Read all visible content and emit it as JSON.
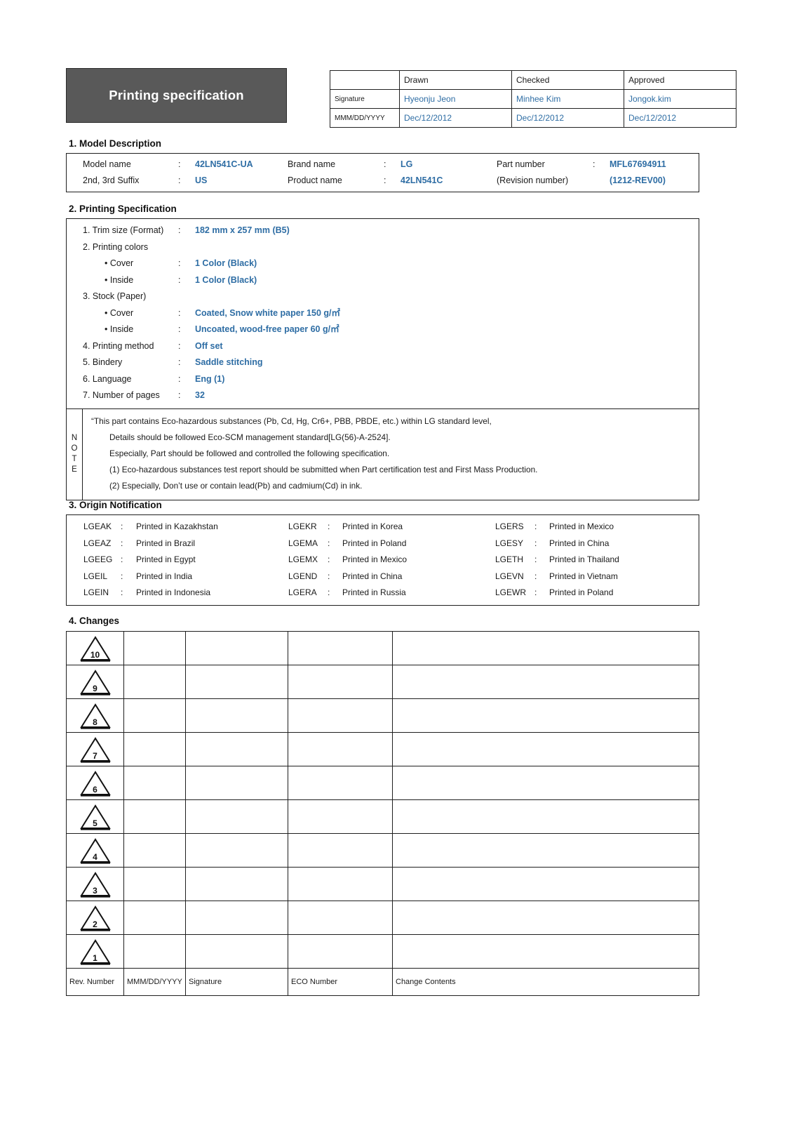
{
  "header": {
    "title": "Printing specification",
    "approval": {
      "row_labels": [
        "",
        "Signature",
        "MMM/DD/YYYY"
      ],
      "columns": [
        "Drawn",
        "Checked",
        "Approved"
      ],
      "signatures": [
        "Hyeonju Jeon",
        "Minhee Kim",
        "Jongok.kim"
      ],
      "dates": [
        "Dec/12/2012",
        "Dec/12/2012",
        "Dec/12/2012"
      ]
    }
  },
  "sections": {
    "model_description": {
      "heading": "1. Model Description",
      "rows": [
        {
          "c1_label": "Model name",
          "c1_colon": ":",
          "c1_value": "42LN541C-UA",
          "c2_label": "Brand name",
          "c2_colon": ":",
          "c2_value": "LG",
          "c3_label": "Part number",
          "c3_colon": ":",
          "c3_value": "MFL67694911"
        },
        {
          "c1_label": "2nd, 3rd Suffix",
          "c1_colon": ":",
          "c1_value": "US",
          "c2_label": "Product name",
          "c2_colon": ":",
          "c2_value": "42LN541C",
          "c3_label": "(Revision number)",
          "c3_colon": "",
          "c3_value": "(1212-REV00)"
        }
      ]
    },
    "printing_specification": {
      "heading": "2. Printing Specification",
      "items": [
        {
          "label": "1. Trim size (Format)",
          "indent": false,
          "colon": ":",
          "value": "182 mm x 257 mm (B5)"
        },
        {
          "label": "2. Printing colors",
          "indent": false,
          "colon": "",
          "value": ""
        },
        {
          "label": "• Cover",
          "indent": true,
          "colon": ":",
          "value": "1 Color (Black)"
        },
        {
          "label": "• Inside",
          "indent": true,
          "colon": ":",
          "value": "1 Color (Black)"
        },
        {
          "label": "3. Stock (Paper)",
          "indent": false,
          "colon": "",
          "value": ""
        },
        {
          "label": "• Cover",
          "indent": true,
          "colon": ":",
          "value": "Coated, Snow white paper 150 g/㎡"
        },
        {
          "label": "• Inside",
          "indent": true,
          "colon": ":",
          "value": "Uncoated, wood-free paper 60 g/㎡"
        },
        {
          "label": "4. Printing method",
          "indent": false,
          "colon": ":",
          "value": "Off set"
        },
        {
          "label": "5. Bindery",
          "indent": false,
          "colon": ":",
          "value": "Saddle stitching"
        },
        {
          "label": "6. Language",
          "indent": false,
          "colon": ":",
          "value": "Eng (1)"
        },
        {
          "label": "7. Number of pages",
          "indent": false,
          "colon": ":",
          "value": "32"
        }
      ],
      "note": {
        "side_label": "NOTE",
        "side_letters": [
          "N",
          "O",
          "T",
          "E"
        ],
        "lines": [
          {
            "text": "“This part contains Eco-hazardous substances (Pb, Cd, Hg, Cr6+, PBB, PBDE, etc.) within LG standard level,",
            "indent": false
          },
          {
            "text": "Details should be followed Eco-SCM management standard[LG(56)-A-2524].",
            "indent": true
          },
          {
            "text": "Especially, Part should be followed and controlled the following specification.",
            "indent": true
          },
          {
            "text": "(1) Eco-hazardous substances test report should be submitted when Part certification test and First Mass Production.",
            "indent": true
          },
          {
            "text": "(2) Especially, Don’t use or contain lead(Pb) and cadmium(Cd) in ink.",
            "indent": true
          }
        ]
      }
    },
    "origin_notification": {
      "heading": "3. Origin Notification",
      "colon": ":",
      "rows": [
        [
          {
            "code": "LGEAK",
            "text": "Printed in Kazakhstan"
          },
          {
            "code": "LGEKR",
            "text": "Printed in Korea"
          },
          {
            "code": "LGERS",
            "text": "Printed in Mexico"
          }
        ],
        [
          {
            "code": "LGEAZ",
            "text": "Printed in Brazil"
          },
          {
            "code": "LGEMA",
            "text": "Printed in Poland"
          },
          {
            "code": "LGESY",
            "text": "Printed in China"
          }
        ],
        [
          {
            "code": "LGEEG",
            "text": "Printed in Egypt"
          },
          {
            "code": "LGEMX",
            "text": "Printed in Mexico"
          },
          {
            "code": "LGETH",
            "text": "Printed in Thailand"
          }
        ],
        [
          {
            "code": "LGEIL",
            "text": "Printed in India"
          },
          {
            "code": "LGEND",
            "text": "Printed in China"
          },
          {
            "code": "LGEVN",
            "text": "Printed in Vietnam"
          }
        ],
        [
          {
            "code": "LGEIN",
            "text": "Printed in Indonesia"
          },
          {
            "code": "LGERA",
            "text": "Printed in Russia"
          },
          {
            "code": "LGEWR",
            "text": "Printed in Poland"
          }
        ]
      ]
    },
    "changes": {
      "heading": "4. Changes",
      "rev_numbers": [
        "10",
        "9",
        "8",
        "7",
        "6",
        "5",
        "4",
        "3",
        "2",
        "1"
      ],
      "rows": [
        {
          "rev": "10",
          "date": "",
          "signature": "",
          "eco": "",
          "contents": ""
        },
        {
          "rev": "9",
          "date": "",
          "signature": "",
          "eco": "",
          "contents": ""
        },
        {
          "rev": "8",
          "date": "",
          "signature": "",
          "eco": "",
          "contents": ""
        },
        {
          "rev": "7",
          "date": "",
          "signature": "",
          "eco": "",
          "contents": ""
        },
        {
          "rev": "6",
          "date": "",
          "signature": "",
          "eco": "",
          "contents": ""
        },
        {
          "rev": "5",
          "date": "",
          "signature": "",
          "eco": "",
          "contents": ""
        },
        {
          "rev": "4",
          "date": "",
          "signature": "",
          "eco": "",
          "contents": ""
        },
        {
          "rev": "3",
          "date": "",
          "signature": "",
          "eco": "",
          "contents": ""
        },
        {
          "rev": "2",
          "date": "",
          "signature": "",
          "eco": "",
          "contents": ""
        },
        {
          "rev": "1",
          "date": "",
          "signature": "",
          "eco": "",
          "contents": ""
        }
      ],
      "footer": {
        "rev_number": "Rev. Number",
        "date": "MMM/DD/YYYY",
        "signature": "Signature",
        "eco_number": "ECO Number",
        "change_contents": "Change Contents"
      }
    }
  },
  "colors": {
    "accent_blue": "#2E6DA4",
    "title_bg": "#595959",
    "border": "#1f1f1f",
    "text": "#1a1a1a"
  }
}
